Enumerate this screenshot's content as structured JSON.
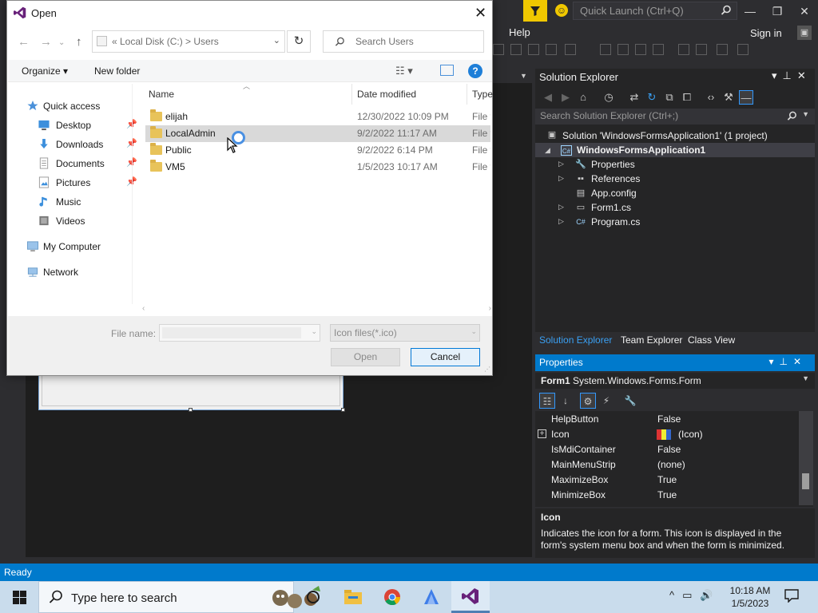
{
  "vs": {
    "quick_launch_placeholder": "Quick Launch (Ctrl+Q)",
    "menu_help": "Help",
    "sign_in": "Sign in",
    "status": "Ready",
    "window_controls": {
      "minimize": "—",
      "restore": "❐",
      "close": "✕"
    }
  },
  "solution_explorer": {
    "title": "Solution Explorer",
    "search_placeholder": "Search Solution Explorer (Ctrl+;)",
    "solution": "Solution 'WindowsFormsApplication1' (1 project)",
    "project": "WindowsFormsApplication1",
    "items": [
      {
        "label": "Properties",
        "icon": "wrench-icon"
      },
      {
        "label": "References",
        "icon": "references-icon"
      },
      {
        "label": "App.config",
        "icon": "config-icon"
      },
      {
        "label": "Form1.cs",
        "icon": "form-icon"
      },
      {
        "label": "Program.cs",
        "icon": "csharp-file-icon"
      }
    ],
    "tabs": [
      "Solution Explorer",
      "Team Explorer",
      "Class View"
    ]
  },
  "properties": {
    "title": "Properties",
    "object": "Form1",
    "object_type": "System.Windows.Forms.Form",
    "rows": [
      {
        "name": "HelpButton",
        "value": "False"
      },
      {
        "name": "Icon",
        "value": "(Icon)"
      },
      {
        "name": "IsMdiContainer",
        "value": "False"
      },
      {
        "name": "MainMenuStrip",
        "value": "(none)"
      },
      {
        "name": "MaximizeBox",
        "value": "True"
      },
      {
        "name": "MinimizeBox",
        "value": "True"
      }
    ],
    "desc_title": "Icon",
    "desc_text": "Indicates the icon for a form. This icon is displayed in the form's system menu box and when the form is minimized."
  },
  "dialog": {
    "title": "Open",
    "address": "«   Local Disk (C:)   >   Users",
    "search_placeholder": "Search Users",
    "organize": "Organize ▾",
    "new_folder": "New folder",
    "nav": [
      {
        "label": "Quick access",
        "icon": "star-icon",
        "pinned": false
      },
      {
        "label": "Desktop",
        "icon": "desktop-icon",
        "pinned": true
      },
      {
        "label": "Downloads",
        "icon": "download-icon",
        "pinned": true
      },
      {
        "label": "Documents",
        "icon": "document-icon",
        "pinned": true
      },
      {
        "label": "Pictures",
        "icon": "pictures-icon",
        "pinned": true
      },
      {
        "label": "Music",
        "icon": "music-icon",
        "pinned": false
      },
      {
        "label": "Videos",
        "icon": "videos-icon",
        "pinned": false
      },
      {
        "label": "My Computer",
        "icon": "computer-icon",
        "pinned": false
      },
      {
        "label": "Network",
        "icon": "network-icon",
        "pinned": false
      }
    ],
    "columns": {
      "name": "Name",
      "date": "Date modified",
      "type": "Type"
    },
    "files": [
      {
        "name": "elijah",
        "date": "12/30/2022 10:09 PM",
        "type": "File folder"
      },
      {
        "name": "LocalAdmin",
        "date": "9/2/2022 11:17 AM",
        "type": "File folder"
      },
      {
        "name": "Public",
        "date": "9/2/2022 6:14 PM",
        "type": "File folder"
      },
      {
        "name": "VM5",
        "date": "1/5/2023 10:17 AM",
        "type": "File folder"
      }
    ],
    "file_name_label": "File name:",
    "file_name_value": "",
    "file_type": "Icon files(*.ico)",
    "open_label": "Open",
    "cancel_label": "Cancel"
  },
  "taskbar": {
    "search_placeholder": "Type here to search",
    "time": "10:18 AM",
    "date": "1/5/2023"
  },
  "colors": {
    "vs_accent": "#007acc",
    "dialog_selection": "#d9d9d9",
    "folder": "#e8c35a"
  }
}
